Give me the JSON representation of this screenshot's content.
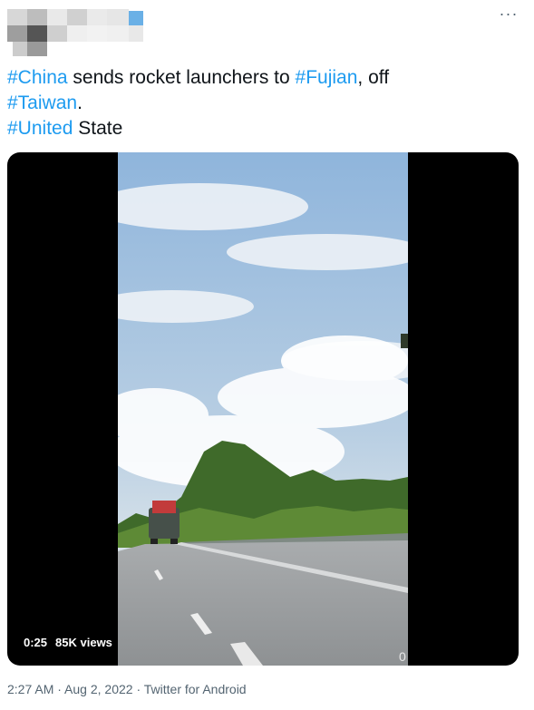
{
  "tweet": {
    "tags": [
      "#China",
      "#Fujian",
      "#Taiwan",
      "#United"
    ],
    "text_1": " sends rocket launchers to ",
    "text_2": ", off",
    "text_3": ".",
    "text_4": " State"
  },
  "video": {
    "duration": "0:25",
    "views": "85K views",
    "frame_corner": "0"
  },
  "meta": {
    "time": "2:27 AM",
    "sep1": " · ",
    "date": "Aug 2, 2022",
    "sep2": " · ",
    "source": "Twitter for Android"
  },
  "menu": {
    "more_label": "···"
  },
  "colors": {
    "link": "#1d9bf0",
    "text": "#0f1419",
    "muted": "#536471"
  }
}
